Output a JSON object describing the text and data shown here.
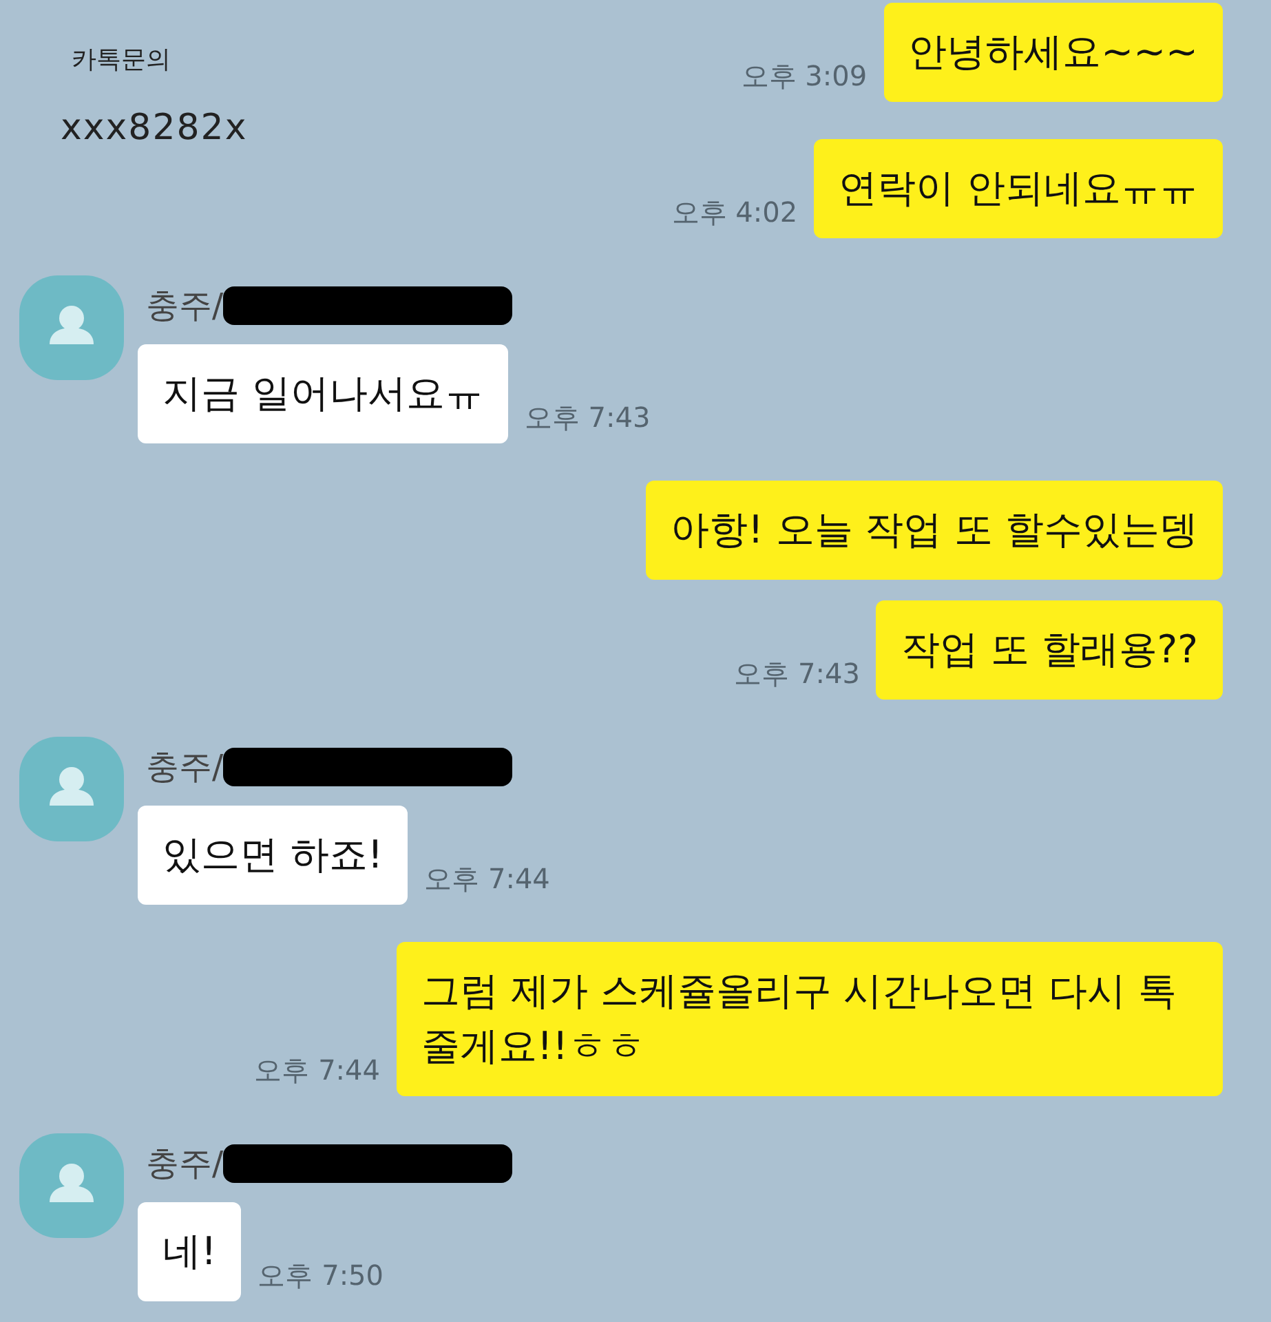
{
  "note": {
    "line_1": "카톡문의",
    "line_2": "xxx8282x"
  },
  "messages": [
    {
      "kind": "mine",
      "text": "안녕하세요~~~",
      "time": "오후 3:09"
    },
    {
      "kind": "mine",
      "text": "연락이 안되네요ㅠㅠ",
      "time": "오후 4:02"
    },
    {
      "kind": "theirs",
      "sender": "충주/",
      "redacted": true,
      "text": "지금 일어나서요ㅠ",
      "time": "오후 7:43"
    },
    {
      "kind": "mine",
      "text": "아항! 오늘 작업 또 할수있는뎅"
    },
    {
      "kind": "mine",
      "text": "작업 또 할래용??",
      "time": "오후 7:43"
    },
    {
      "kind": "theirs",
      "sender": "충주/",
      "redacted": true,
      "text": "있으면 하죠!",
      "time": "오후 7:44"
    },
    {
      "kind": "mine",
      "text": "그럼 제가 스케쥴올리구 시간나오면 다시 톡 줄게요!!ㅎㅎ",
      "time": "오후 7:44"
    },
    {
      "kind": "theirs",
      "sender": "충주/",
      "redacted": true,
      "text": "네!",
      "time": "오후 7:50"
    }
  ]
}
